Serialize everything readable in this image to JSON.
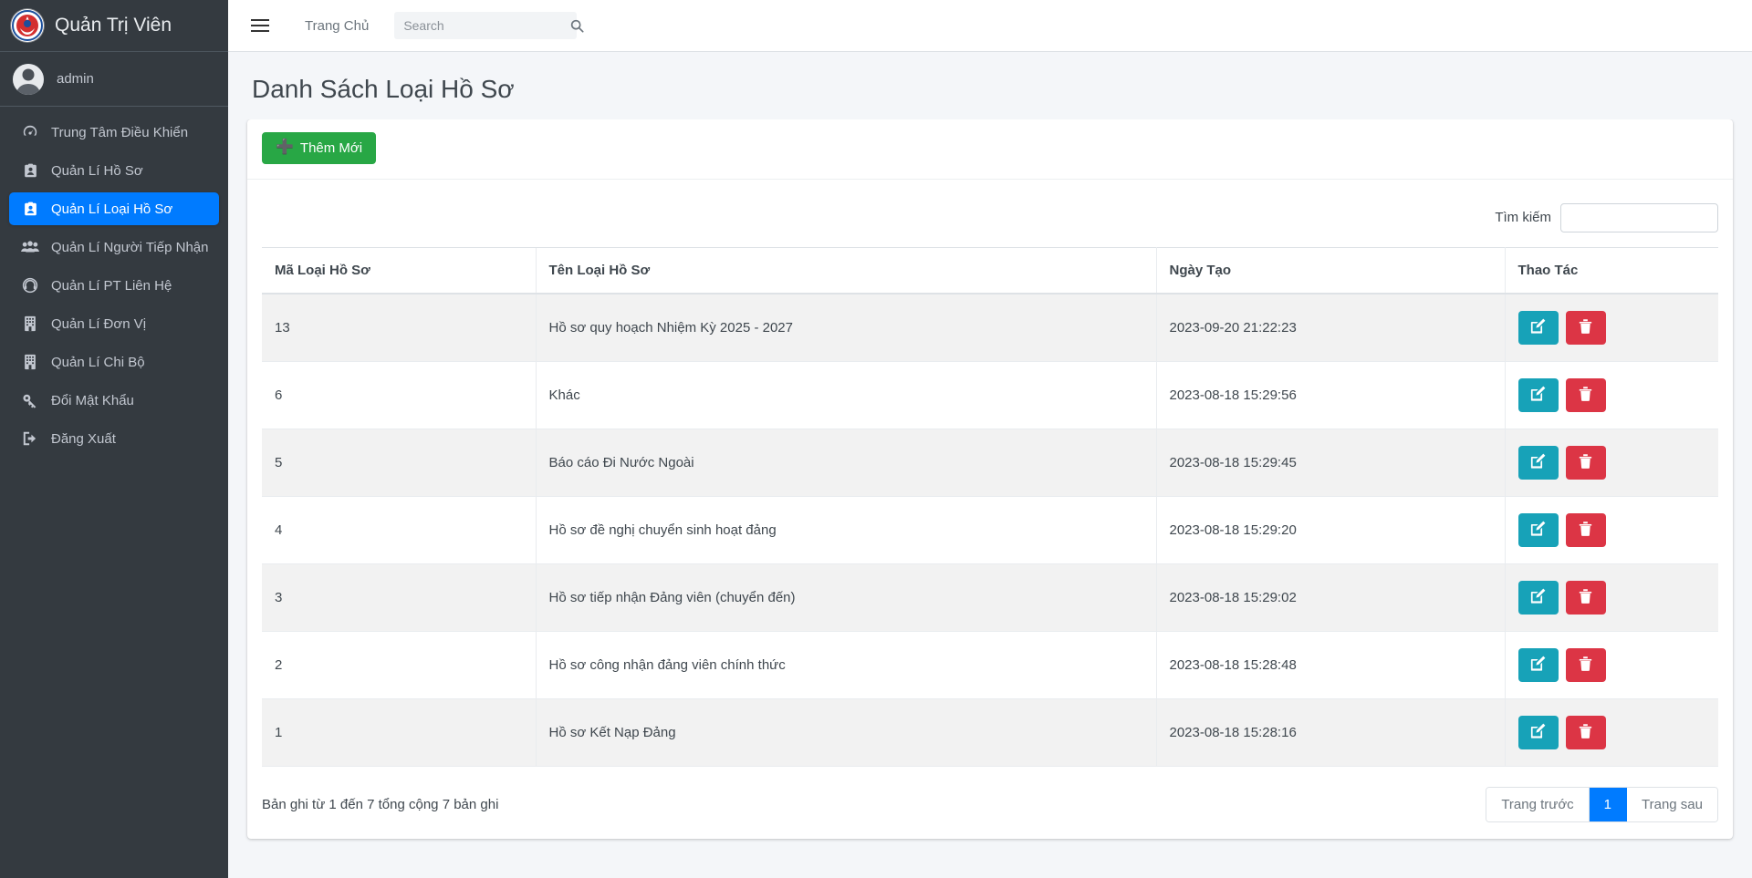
{
  "sidebar": {
    "brand": {
      "title": "Quản Trị Viên",
      "logo_icon": "emblem-logo"
    },
    "user": {
      "name": "admin",
      "avatar_icon": "user-avatar"
    },
    "items": [
      {
        "label": "Trung Tâm Điều Khiển",
        "icon": "dashboard-gauge-icon",
        "active": false
      },
      {
        "label": "Quản Lí Hồ Sơ",
        "icon": "id-card-icon",
        "active": false
      },
      {
        "label": "Quản Lí Loại Hồ Sơ",
        "icon": "id-card-icon",
        "active": true
      },
      {
        "label": "Quản Lí Người Tiếp Nhận",
        "icon": "users-group-icon",
        "active": false
      },
      {
        "label": "Quản Lí PT Liên Hệ",
        "icon": "headset-icon",
        "active": false
      },
      {
        "label": "Quản Lí Đơn Vị",
        "icon": "building-icon",
        "active": false
      },
      {
        "label": "Quản Lí Chi Bộ",
        "icon": "building-icon",
        "active": false
      },
      {
        "label": "Đổi Mật Khẩu",
        "icon": "key-icon",
        "active": false
      },
      {
        "label": "Đăng Xuất",
        "icon": "sign-out-icon",
        "active": false
      }
    ]
  },
  "topbar": {
    "menu_toggle_icon": "hamburger-icon",
    "home_link": "Trang Chủ",
    "search": {
      "value": "",
      "placeholder": "Search",
      "icon": "search-icon"
    }
  },
  "page": {
    "title": "Danh Sách Loại Hồ Sơ"
  },
  "toolbar": {
    "add_label": "Thêm Mới",
    "add_icon": "plus-icon"
  },
  "filter": {
    "label": "Tìm kiếm",
    "value": "",
    "placeholder": ""
  },
  "table": {
    "columns": [
      "Mã Loại Hồ Sơ",
      "Tên Loại Hồ Sơ",
      "Ngày Tạo",
      "Thao Tác"
    ],
    "rows": [
      {
        "code": "13",
        "name": "Hồ sơ quy hoạch Nhiệm Kỳ 2025 - 2027",
        "date": "2023-09-20 21:22:23"
      },
      {
        "code": "6",
        "name": "Khác",
        "date": "2023-08-18 15:29:56"
      },
      {
        "code": "5",
        "name": "Báo cáo Đi Nước Ngoài",
        "date": "2023-08-18 15:29:45"
      },
      {
        "code": "4",
        "name": "Hồ sơ đề nghị chuyển sinh hoạt đảng",
        "date": "2023-08-18 15:29:20"
      },
      {
        "code": "3",
        "name": "Hồ sơ tiếp nhận Đảng viên (chuyển đến)",
        "date": "2023-08-18 15:29:02"
      },
      {
        "code": "2",
        "name": "Hồ sơ công nhận đảng viên chính thức",
        "date": "2023-08-18 15:28:48"
      },
      {
        "code": "1",
        "name": "Hồ sơ Kết Nạp Đảng",
        "date": "2023-08-18 15:28:16"
      }
    ],
    "row_actions": {
      "edit_icon": "edit-pencil-icon",
      "delete_icon": "trash-icon"
    }
  },
  "footer": {
    "info": "Bản ghi từ 1 đến 7 tổng cộng 7 bản ghi",
    "pagination": {
      "prev": "Trang trước",
      "current": "1",
      "next": "Trang sau"
    }
  },
  "colors": {
    "sidebar_bg": "#343a40",
    "accent_blue": "#007bff",
    "add_green": "#28a745",
    "edit_teal": "#17a2b8",
    "delete_red": "#dc3545",
    "page_bg": "#f4f6f9"
  }
}
